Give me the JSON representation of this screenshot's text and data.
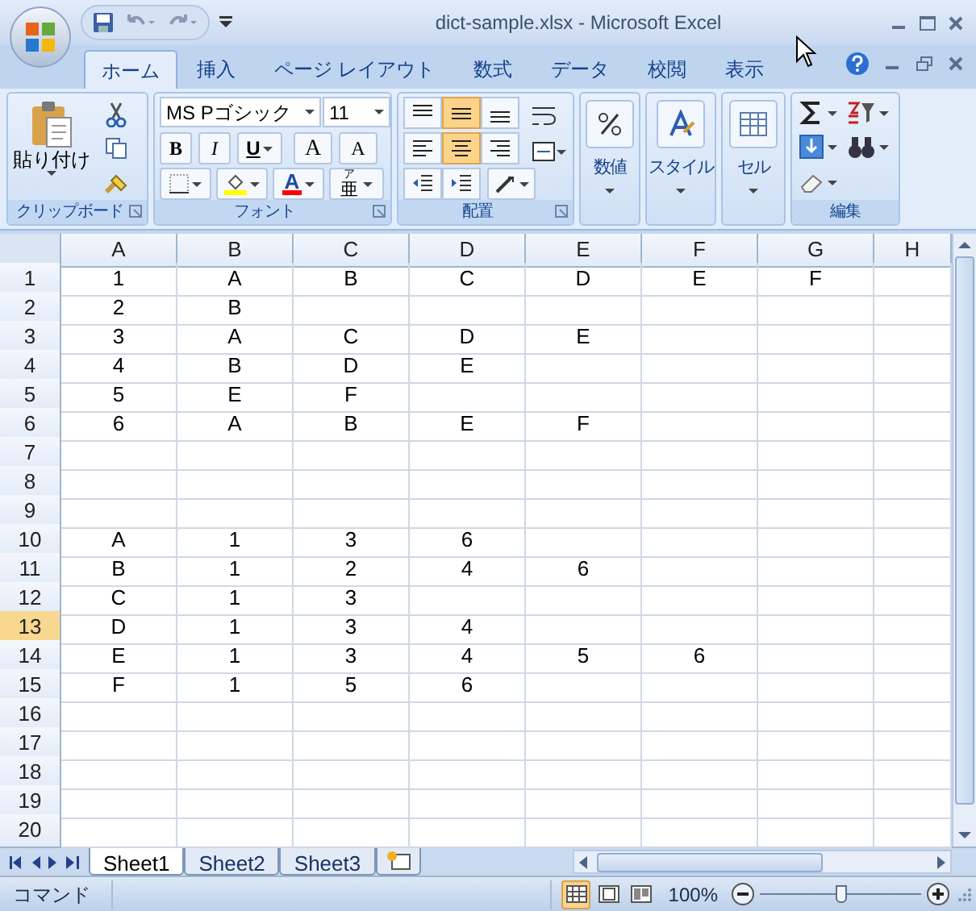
{
  "title_bar": {
    "title": "dict-sample.xlsx - Microsoft Excel"
  },
  "ribbon_tabs": [
    {
      "label": "ホーム",
      "selected": true
    },
    {
      "label": "挿入",
      "selected": false
    },
    {
      "label": "ページ レイアウト",
      "selected": false
    },
    {
      "label": "数式",
      "selected": false
    },
    {
      "label": "データ",
      "selected": false
    },
    {
      "label": "校閲",
      "selected": false
    },
    {
      "label": "表示",
      "selected": false
    }
  ],
  "ribbon": {
    "clipboard": {
      "label": "クリップボード",
      "paste": "貼り付け"
    },
    "font": {
      "label": "フォント",
      "font_name": "MS Pゴシック",
      "font_size": "11",
      "bold": "B",
      "italic": "I",
      "underline": "U",
      "grow": "A",
      "shrink": "A",
      "font_color": "A",
      "phonetic_ruby": "ア",
      "phonetic": "亜"
    },
    "alignment": {
      "label": "配置",
      "buttons": [
        {
          "kind": "top",
          "selected": false
        },
        {
          "kind": "middle",
          "selected": true
        },
        {
          "kind": "bottom",
          "selected": false
        },
        {
          "kind": "left",
          "selected": false
        },
        {
          "kind": "center",
          "selected": true
        },
        {
          "kind": "right",
          "selected": false
        }
      ]
    },
    "number": "数値",
    "styles": "スタイル",
    "cells": "セル",
    "editing": {
      "label": "編集"
    }
  },
  "columns": [
    "A",
    "B",
    "C",
    "D",
    "E",
    "F",
    "G",
    "H"
  ],
  "rows": [
    {
      "header": "1",
      "selected": false,
      "cells": [
        "1",
        "A",
        "B",
        "C",
        "D",
        "E",
        "F"
      ]
    },
    {
      "header": "2",
      "selected": false,
      "cells": [
        "2",
        "B"
      ]
    },
    {
      "header": "3",
      "selected": false,
      "cells": [
        "3",
        "A",
        "C",
        "D",
        "E"
      ]
    },
    {
      "header": "4",
      "selected": false,
      "cells": [
        "4",
        "B",
        "D",
        "E"
      ]
    },
    {
      "header": "5",
      "selected": false,
      "cells": [
        "5",
        "E",
        "F"
      ]
    },
    {
      "header": "6",
      "selected": false,
      "cells": [
        "6",
        "A",
        "B",
        "E",
        "F"
      ]
    },
    {
      "header": "7",
      "selected": false,
      "cells": []
    },
    {
      "header": "8",
      "selected": false,
      "cells": []
    },
    {
      "header": "9",
      "selected": false,
      "cells": []
    },
    {
      "header": "10",
      "selected": false,
      "cells": [
        "A",
        "1",
        "3",
        "6"
      ]
    },
    {
      "header": "11",
      "selected": false,
      "cells": [
        "B",
        "1",
        "2",
        "4",
        "6"
      ]
    },
    {
      "header": "12",
      "selected": false,
      "cells": [
        "C",
        "1",
        "3"
      ]
    },
    {
      "header": "13",
      "selected": true,
      "cells": [
        "D",
        "1",
        "3",
        "4"
      ]
    },
    {
      "header": "14",
      "selected": false,
      "cells": [
        "E",
        "1",
        "3",
        "4",
        "5",
        "6"
      ]
    },
    {
      "header": "15",
      "selected": false,
      "cells": [
        "F",
        "1",
        "5",
        "6"
      ]
    },
    {
      "header": "16",
      "selected": false,
      "cells": []
    },
    {
      "header": "17",
      "selected": false,
      "cells": []
    },
    {
      "header": "18",
      "selected": false,
      "cells": []
    },
    {
      "header": "19",
      "selected": false,
      "cells": []
    },
    {
      "header": "20",
      "selected": false,
      "cells": []
    }
  ],
  "sheet_tabs": [
    {
      "label": "Sheet1",
      "selected": true
    },
    {
      "label": "Sheet2",
      "selected": false
    },
    {
      "label": "Sheet3",
      "selected": false
    }
  ],
  "status_bar": {
    "mode": "コマンド",
    "views": [
      {
        "kind": "normal",
        "selected": true
      },
      {
        "kind": "layout",
        "selected": false
      },
      {
        "kind": "break",
        "selected": false
      }
    ],
    "zoom": "100%",
    "zoom_slider": {
      "level": 0.5
    }
  }
}
